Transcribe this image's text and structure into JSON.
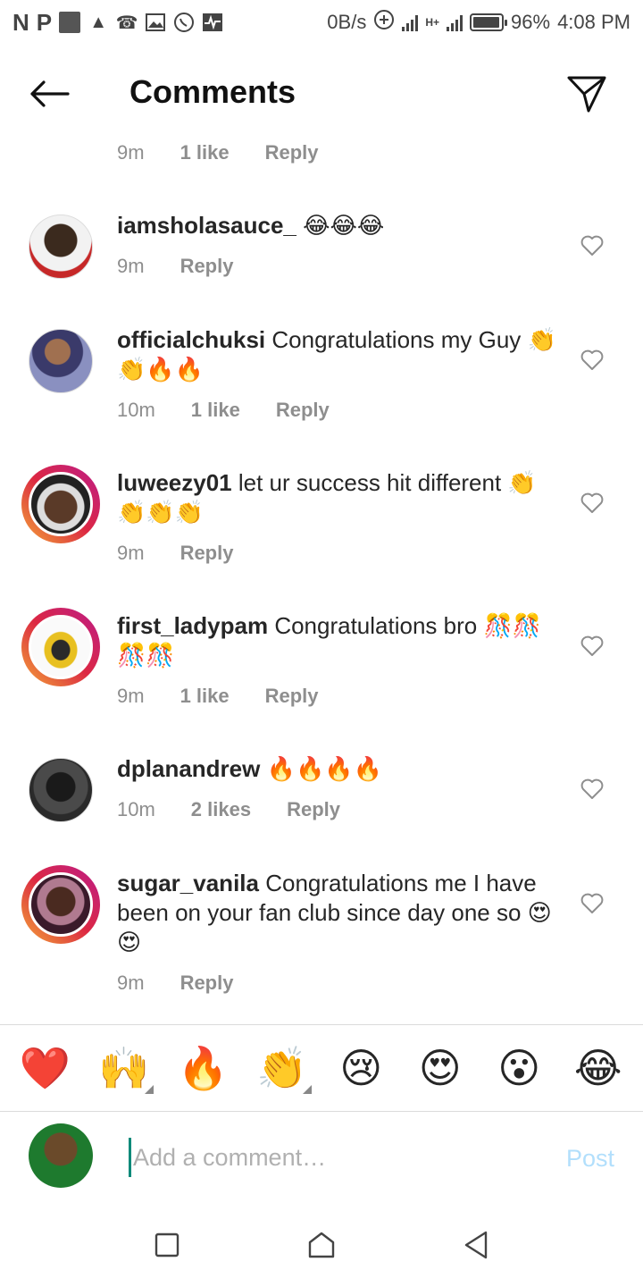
{
  "status_bar": {
    "left_letters": [
      "N",
      "P"
    ],
    "net_speed": "0B/s",
    "network_type": "H+",
    "battery_percent": "96%",
    "battery_level": 0.96,
    "time": "4:08 PM"
  },
  "header": {
    "title": "Comments"
  },
  "top_meta": {
    "time": "9m",
    "likes": "1 like",
    "reply": "Reply"
  },
  "comments": [
    {
      "user": "iamsholasauce_",
      "text": "😂😂😂",
      "time": "9m",
      "likes": "",
      "reply": "Reply"
    },
    {
      "user": "officialchuksi",
      "text": "Congratulations my Guy 👏👏🔥🔥",
      "time": "10m",
      "likes": "1 like",
      "reply": "Reply"
    },
    {
      "user": "luweezy01",
      "text": "let ur success hit different 👏👏👏👏",
      "time": "9m",
      "likes": "",
      "reply": "Reply"
    },
    {
      "user": "first_ladypam",
      "text": "Congratulations bro 🎊🎊🎊🎊",
      "time": "9m",
      "likes": "1 like",
      "reply": "Reply"
    },
    {
      "user": "dplanandrew",
      "text": "🔥🔥🔥🔥",
      "time": "10m",
      "likes": "2 likes",
      "reply": "Reply"
    },
    {
      "user": "sugar_vanila",
      "text": "Congratulations me I have been on your fan club since day one so 😍😍",
      "time": "9m",
      "likes": "",
      "reply": "Reply"
    }
  ],
  "emoji_bar": [
    "❤️",
    "🙌",
    "🔥",
    "👏",
    "😢",
    "😍",
    "😮",
    "😂"
  ],
  "composer": {
    "placeholder": "Add a comment…",
    "post_label": "Post"
  },
  "colors": {
    "accent_ring_start": "#f9a23a",
    "accent_ring_end": "#bc1888",
    "post_disabled": "#b2dffc",
    "meta_gray": "#8e8e8e"
  }
}
